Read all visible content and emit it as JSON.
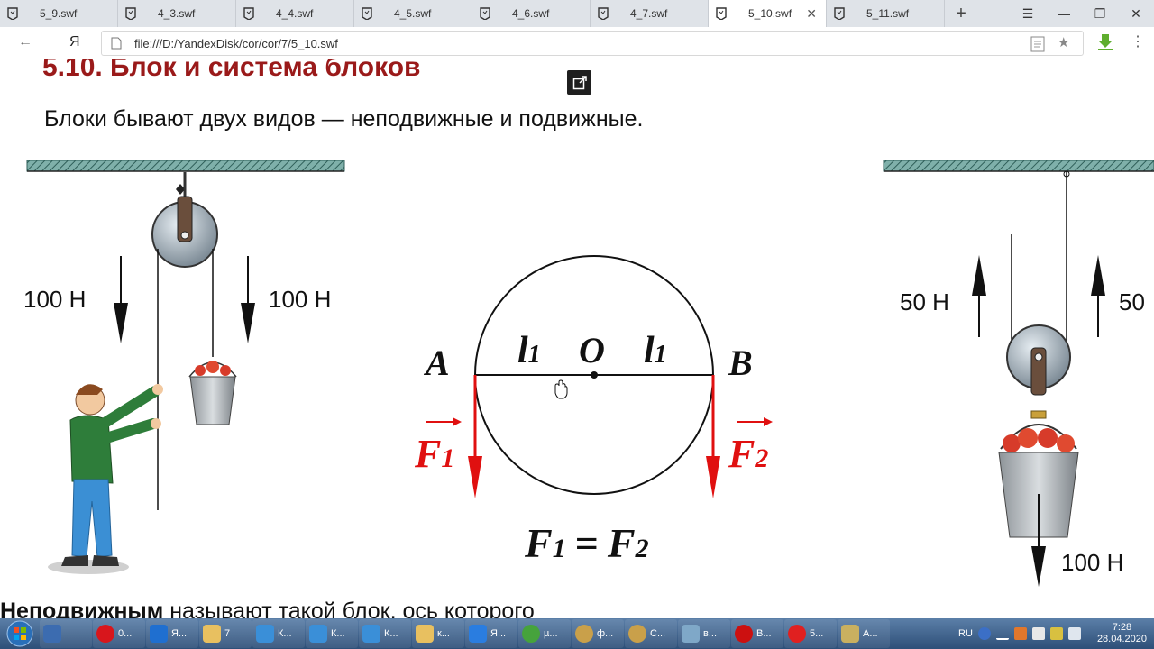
{
  "browser": {
    "tabs": [
      {
        "label": "5_9.swf",
        "active": false
      },
      {
        "label": "4_3.swf",
        "active": false
      },
      {
        "label": "4_4.swf",
        "active": false
      },
      {
        "label": "4_5.swf",
        "active": false
      },
      {
        "label": "4_6.swf",
        "active": false
      },
      {
        "label": "4_7.swf",
        "active": false
      },
      {
        "label": "5_10.swf",
        "active": true
      },
      {
        "label": "5_11.swf",
        "active": false
      }
    ],
    "new_tab": "+",
    "back_icon": "back-arrow-icon",
    "home_label": "Я",
    "url": "file:///D:/YandexDisk/cor/cor/7/5_10.swf"
  },
  "page": {
    "title": "5.10. Блок и система блоков",
    "intro": "Блоки бывают двух видов — неподвижные и подвижные.",
    "bottom_bold": "Неподвижным",
    "bottom_rest": " называют такой блок, ось которого",
    "fixed_block": {
      "left_force": "100 Н",
      "right_force": "100 Н"
    },
    "diagram": {
      "A": "A",
      "B": "B",
      "O": "O",
      "l": "l",
      "sub": "1",
      "F": "F",
      "F1_sub": "1",
      "F2_sub": "2",
      "eq": "="
    },
    "movable_block": {
      "left_force": "50 Н",
      "right_force": "50",
      "bottom_force": "100 Н"
    },
    "colors": {
      "title": "#9a1a1a",
      "force_red": "#e01010",
      "ceiling": "#6e9e98"
    }
  },
  "taskbar": {
    "items": [
      {
        "label": "",
        "color": "#3c6cb0"
      },
      {
        "label": "0...",
        "color": "#d8161c"
      },
      {
        "label": "Я...",
        "color": "#1f6fd0"
      },
      {
        "label": "7",
        "color": "#e8c060"
      },
      {
        "label": "К...",
        "color": "#3a8fd8"
      },
      {
        "label": "К...",
        "color": "#3a8fd8"
      },
      {
        "label": "К...",
        "color": "#3a8fd8"
      },
      {
        "label": "к...",
        "color": "#e8c060"
      },
      {
        "label": "Я...",
        "color": "#2a7de0"
      },
      {
        "label": "µ...",
        "color": "#46a33c"
      },
      {
        "label": "ф...",
        "color": "#c9a04a"
      },
      {
        "label": "С...",
        "color": "#c9a04a"
      },
      {
        "label": "в...",
        "color": "#7fa8c8"
      },
      {
        "label": "В...",
        "color": "#cc1010"
      },
      {
        "label": "5...",
        "color": "#e02020"
      },
      {
        "label": "А...",
        "color": "#c9b060"
      }
    ],
    "lang": "RU",
    "time": "7:28",
    "date": "28.04.2020"
  }
}
